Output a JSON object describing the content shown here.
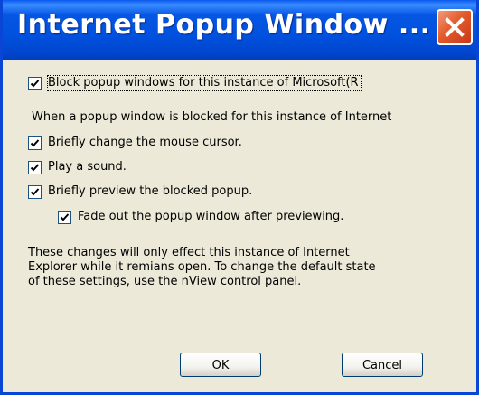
{
  "window": {
    "title": "Internet Popup Window ..."
  },
  "options": {
    "block_popups": {
      "label": "Block popup windows for this instance of Microsoft(R",
      "checked": true
    },
    "section_text": "When a popup window is blocked for this instance of Internet",
    "change_cursor": {
      "label": "Briefly change the mouse cursor.",
      "checked": true
    },
    "play_sound": {
      "label": "Play a sound.",
      "checked": true
    },
    "preview_popup": {
      "label": "Briefly preview the blocked popup.",
      "checked": true
    },
    "fade_out": {
      "label": "Fade out the popup window after previewing.",
      "checked": true
    }
  },
  "note": "These changes will only effect this instance of Internet Explorer while it remians open. To change the default state of these settings, use the nView control panel.",
  "buttons": {
    "ok": "OK",
    "cancel": "Cancel"
  },
  "colors": {
    "titlebar": "#0054e3",
    "close": "#e35a2b",
    "dialog_bg": "#ece9d8"
  }
}
